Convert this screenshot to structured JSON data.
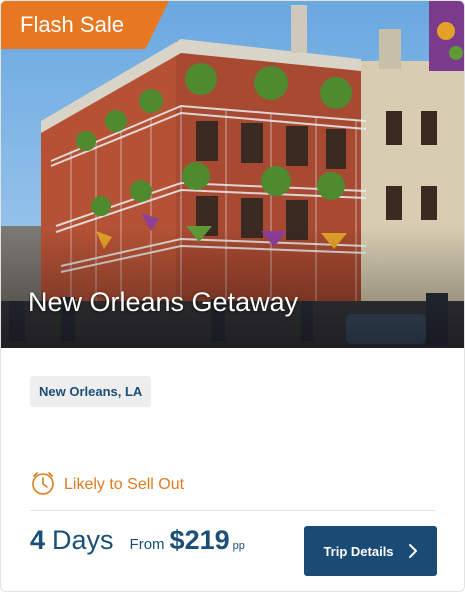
{
  "badge": {
    "label": "Flash Sale"
  },
  "hero": {
    "title": "New Orleans Getaway"
  },
  "location": "New Orleans, LA",
  "status": {
    "icon": "clock-icon",
    "label": "Likely to Sell Out"
  },
  "trip": {
    "days_count": "4",
    "days_word": "Days",
    "from_label": "From",
    "price": "$219",
    "price_suffix": "pp"
  },
  "cta": {
    "label": "Trip Details",
    "icon": "chevron-right-icon"
  },
  "colors": {
    "badge": "#e87722",
    "brand": "#1b4f78",
    "button": "#1a4b75",
    "status": "#e07a1f"
  }
}
